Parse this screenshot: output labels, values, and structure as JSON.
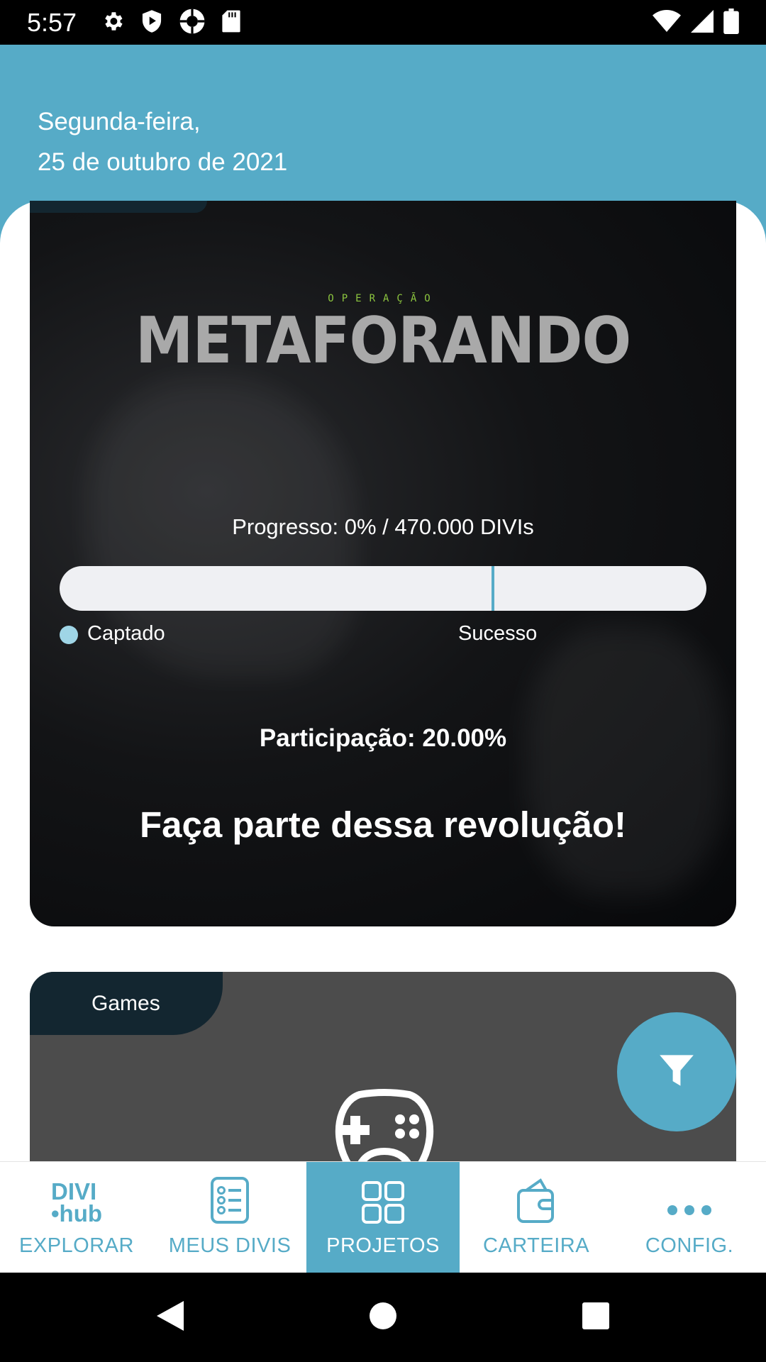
{
  "status_bar": {
    "time": "5:57",
    "left_icons": [
      "gear-icon",
      "shield-play-icon",
      "aperture-icon",
      "sd-card-icon"
    ],
    "right_icons": [
      "wifi-icon",
      "signal-icon",
      "battery-icon"
    ]
  },
  "header": {
    "weekday": "Segunda-feira,",
    "date": "25 de outubro de 2021"
  },
  "project_card": {
    "logo_overline": "OPERAÇÃO",
    "logo_title": "METAFORANDO",
    "progress_label": "Progresso: 0% / 470.000 DIVIs",
    "progress_fraction": 0,
    "success_marker_fraction": 0.67,
    "legend_captado": "Captado",
    "legend_sucesso": "Sucesso",
    "participacao": "Participação: 20.00%",
    "slogan": "Faça parte dessa revolução!",
    "colors": {
      "accent": "#56abc7",
      "logo_green": "#8dc63f"
    }
  },
  "games_card": {
    "category": "Games",
    "icon": "gamepad-icon"
  },
  "fab": {
    "icon": "filter-icon"
  },
  "bottom_nav": {
    "items": [
      {
        "label": "EXPLORAR",
        "icon": "divihub-logo",
        "logo_line1": "DIVI",
        "logo_line2": "•hub",
        "active": false
      },
      {
        "label": "MEUS DIVIS",
        "icon": "list-icon",
        "active": false
      },
      {
        "label": "PROJETOS",
        "icon": "grid-icon",
        "active": true
      },
      {
        "label": "CARTEIRA",
        "icon": "wallet-icon",
        "active": false
      },
      {
        "label": "CONFIG.",
        "icon": "more-icon",
        "active": false
      }
    ]
  },
  "system_nav": {
    "icons": [
      "back-icon",
      "home-icon",
      "recents-icon"
    ]
  },
  "colors": {
    "primary": "#56abc7",
    "dark_tag": "#132630",
    "card_grey": "#4c4c4c"
  }
}
